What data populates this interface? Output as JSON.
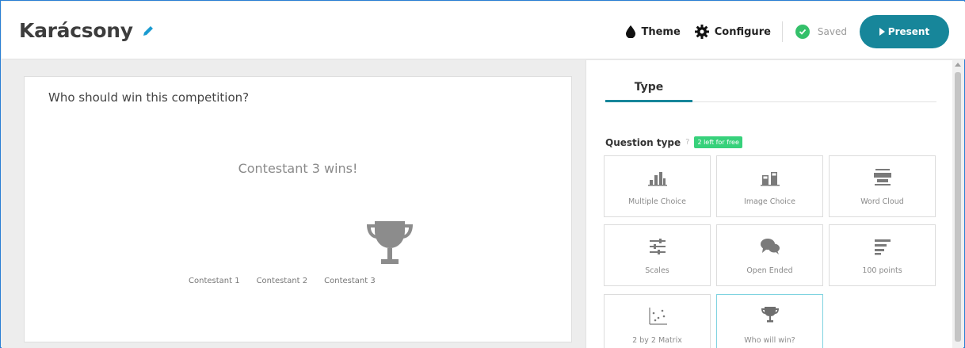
{
  "header": {
    "title": "Karácsony",
    "theme_label": "Theme",
    "configure_label": "Configure",
    "saved_label": "Saved",
    "present_label": "Present"
  },
  "slide": {
    "question": "Who should win this competition?",
    "winner_text": "Contestant 3 wins!",
    "contestants": [
      "Contestant 1",
      "Contestant 2",
      "Contestant 3"
    ]
  },
  "panel": {
    "tab_type": "Type",
    "question_type_label": "Question type",
    "help": "?",
    "free_badge": "2 left for free",
    "types": [
      {
        "label": "Multiple Choice",
        "icon": "bar-chart-icon"
      },
      {
        "label": "Image Choice",
        "icon": "image-choice-icon"
      },
      {
        "label": "Word Cloud",
        "icon": "word-cloud-icon"
      },
      {
        "label": "Scales",
        "icon": "sliders-icon"
      },
      {
        "label": "Open Ended",
        "icon": "speech-bubbles-icon"
      },
      {
        "label": "100 points",
        "icon": "text-lines-icon"
      },
      {
        "label": "2 by 2 Matrix",
        "icon": "scatter-matrix-icon"
      },
      {
        "label": "Who will win?",
        "icon": "trophy-icon",
        "selected": true
      }
    ]
  },
  "colors": {
    "accent": "#17869a",
    "saved_green": "#34c06a",
    "badge_green": "#37d17b"
  }
}
